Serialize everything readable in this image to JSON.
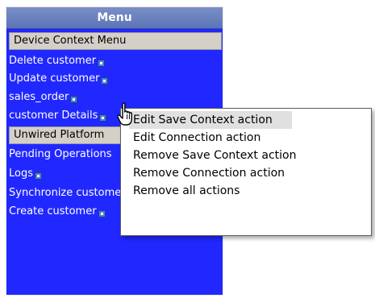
{
  "menu": {
    "title": "Menu",
    "sections": {
      "device": "Device Context Menu",
      "unwired": "Unwired Platform"
    },
    "items": [
      {
        "label": "Delete customer"
      },
      {
        "label": "Update customer"
      },
      {
        "label": "sales_order"
      },
      {
        "label": "customer Details"
      },
      {
        "label": "Pending Operations"
      },
      {
        "label": "Logs"
      },
      {
        "label": "Synchronize customer"
      },
      {
        "label": "Create customer"
      }
    ]
  },
  "context_menu": {
    "items": [
      {
        "label": "Edit Save Context action",
        "active": true
      },
      {
        "label": "Edit Connection action"
      },
      {
        "label": "Remove Save Context action"
      },
      {
        "label": "Remove Connection action"
      },
      {
        "label": "Remove all actions"
      }
    ]
  },
  "colors": {
    "panel_bg": "#2128ff",
    "header_bg": "#6a82c0",
    "section_bg": "#d4d0c8",
    "context_active_bg": "#e0e0e0"
  },
  "icons": {
    "item_icon": "small-blue-square-icon",
    "cursor": "hand-pointer-icon"
  }
}
